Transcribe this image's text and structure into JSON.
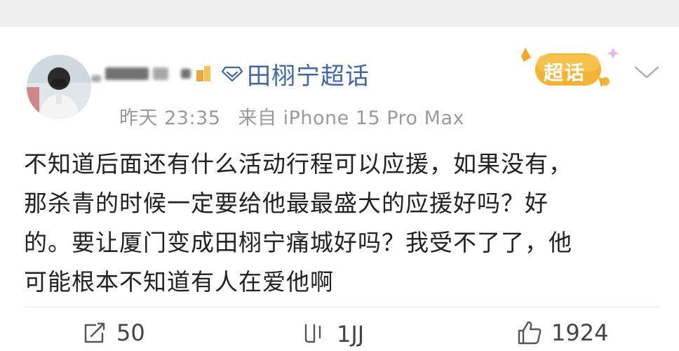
{
  "topic": {
    "name": "田栩宁超话"
  },
  "badge": {
    "text": "超话"
  },
  "meta": {
    "time": "昨天 23:35",
    "source": "来自 iPhone 15 Pro Max"
  },
  "post": {
    "lines": [
      "不知道后面还有什么活动行程可以应援，如果没有，",
      "那杀青的时候一定要给他最最盛大的应援好吗？好",
      "的。要让厦门变成田栩宁痛城好吗？我受不了了，他",
      "可能根本不知道有人在爱他啊"
    ]
  },
  "actions": {
    "repost_count": "50",
    "comment_count": "1JJ",
    "like_count": "1924"
  },
  "icons": {
    "repost": "share-icon",
    "comment": "comment-icon",
    "like": "thumbs-up-icon",
    "topic": "diamond-icon",
    "menu": "chevron-down-icon"
  },
  "colors": {
    "topic_link": "#3f67a8",
    "meta_text": "#9a9a9a",
    "badge_orange": "#f5a623"
  }
}
